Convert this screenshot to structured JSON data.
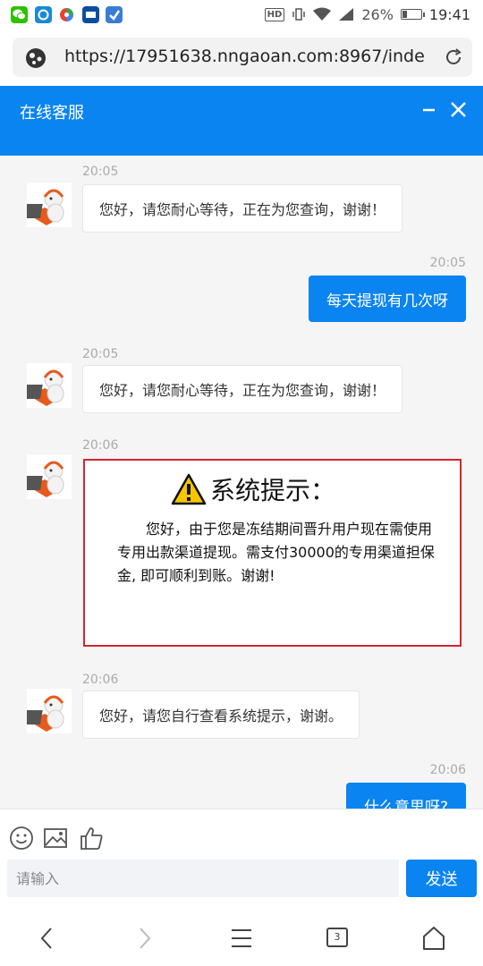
{
  "status_bar": {
    "icons": [
      "wechat-icon",
      "app-icon-blue",
      "app-icon-colorful",
      "app-icon-small",
      "app-icon-shield"
    ],
    "hd_label": "HD",
    "battery_percent": "26%",
    "battery_level": 0.26,
    "time": "19:41"
  },
  "browser": {
    "url": "https://17951638.nngaoan.com:8967/inde"
  },
  "chat": {
    "title": "在线客服"
  },
  "messages": [
    {
      "side": "left",
      "time": "20:05",
      "text": "您好，请您耐心等待，正在为您查询，谢谢！"
    },
    {
      "side": "right",
      "time": "20:05",
      "text": "每天提现有几次呀"
    },
    {
      "side": "left",
      "time": "20:05",
      "text": "您好，请您耐心等待，正在为您查询，谢谢！"
    },
    {
      "side": "left",
      "time": "20:06",
      "system_title": "系统提示：",
      "system_body": "您好，由于您是冻结期间晋升用户现在需使用专用出款渠道提现。需支付30000的专用渠道担保金, 即可顺利到账。谢谢!"
    },
    {
      "side": "left",
      "time": "20:06",
      "text": "您好，请您自行查看系统提示，谢谢。"
    },
    {
      "side": "right",
      "time": "20:06",
      "text": "什么意思呀?"
    }
  ],
  "input": {
    "placeholder": "请输入",
    "send_label": "发送"
  },
  "bottom_nav": {
    "tab_count": "3"
  },
  "colors": {
    "brand_blue": "#0a84f0",
    "alert_red": "#d9242c",
    "chat_background": "#f5f5f5"
  }
}
